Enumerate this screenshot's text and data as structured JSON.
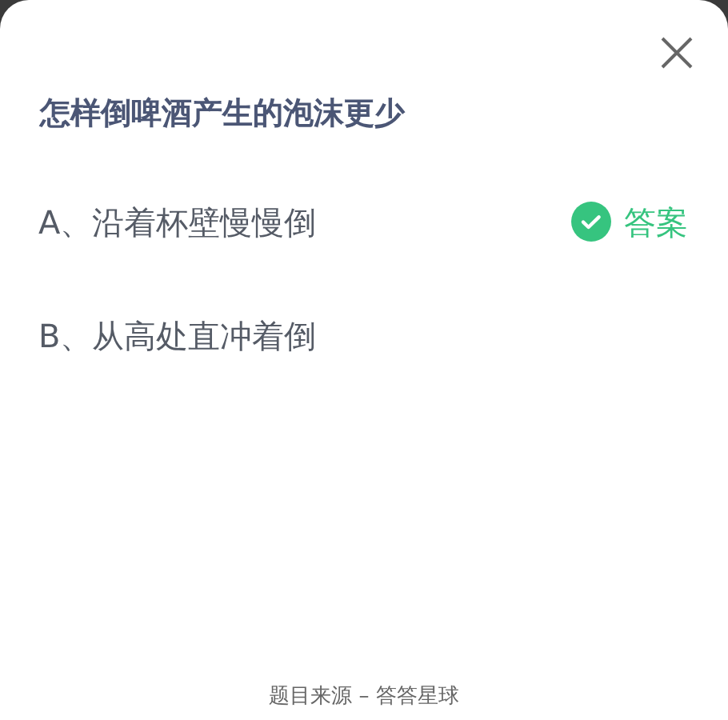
{
  "question": {
    "title": "怎样倒啤酒产生的泡沫更少"
  },
  "options": [
    {
      "label": "A、沿着杯壁慢慢倒",
      "correct": true,
      "answer_label": "答案"
    },
    {
      "label": "B、从高处直冲着倒",
      "correct": false
    }
  ],
  "footer": "题目来源 – 答答星球"
}
